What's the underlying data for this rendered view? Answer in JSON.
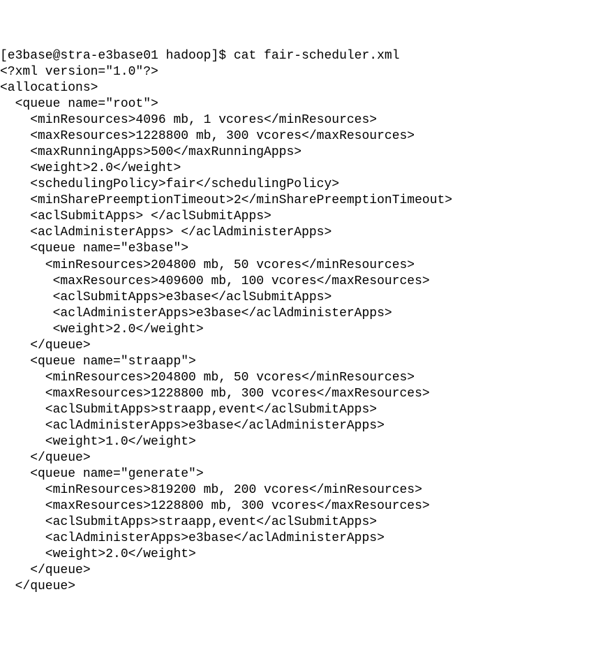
{
  "lines": [
    "[e3base@stra-e3base01 hadoop]$ cat fair-scheduler.xml",
    "<?xml version=\"1.0\"?>",
    "<allocations>",
    "  <queue name=\"root\">",
    "    <minResources>4096 mb, 1 vcores</minResources>",
    "    <maxResources>1228800 mb, 300 vcores</maxResources>",
    "    <maxRunningApps>500</maxRunningApps>",
    "    <weight>2.0</weight>",
    "    <schedulingPolicy>fair</schedulingPolicy>",
    "    <minSharePreemptionTimeout>2</minSharePreemptionTimeout>",
    "    <aclSubmitApps> </aclSubmitApps>",
    "    <aclAdministerApps> </aclAdministerApps>",
    "    <queue name=\"e3base\">",
    "      <minResources>204800 mb, 50 vcores</minResources>",
    "       <maxResources>409600 mb, 100 vcores</maxResources>",
    "       <aclSubmitApps>e3base</aclSubmitApps>",
    "       <aclAdministerApps>e3base</aclAdministerApps>",
    "       <weight>2.0</weight>",
    "    </queue>",
    "    <queue name=\"straapp\">",
    "      <minResources>204800 mb, 50 vcores</minResources>",
    "      <maxResources>1228800 mb, 300 vcores</maxResources>",
    "      <aclSubmitApps>straapp,event</aclSubmitApps>",
    "      <aclAdministerApps>e3base</aclAdministerApps>",
    "      <weight>1.0</weight>",
    "    </queue>",
    "    <queue name=\"generate\">",
    "      <minResources>819200 mb, 200 vcores</minResources>",
    "      <maxResources>1228800 mb, 300 vcores</maxResources>",
    "      <aclSubmitApps>straapp,event</aclSubmitApps>",
    "      <aclAdministerApps>e3base</aclAdministerApps>",
    "      <weight>2.0</weight>",
    "    </queue>",
    "  </queue>"
  ]
}
